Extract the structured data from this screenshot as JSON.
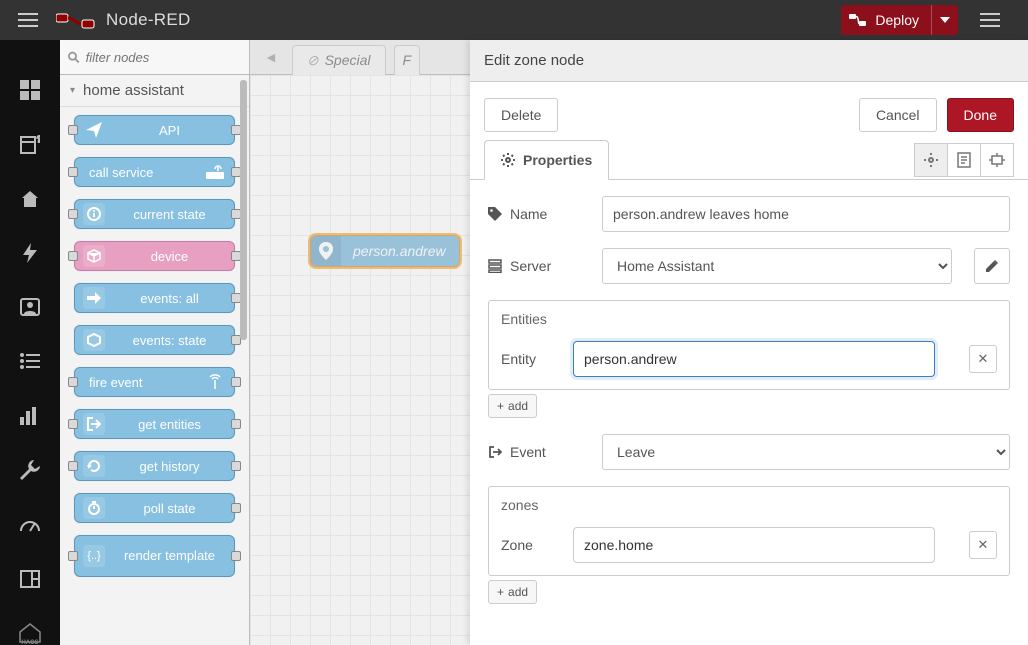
{
  "header": {
    "app_title": "Node-RED",
    "deploy_label": "Deploy"
  },
  "palette": {
    "filter_placeholder": "filter nodes",
    "category_label": "home assistant",
    "nodes": [
      {
        "label": "API"
      },
      {
        "label": "call service"
      },
      {
        "label": "current state"
      },
      {
        "label": "device"
      },
      {
        "label": "events: all"
      },
      {
        "label": "events: state"
      },
      {
        "label": "fire event"
      },
      {
        "label": "get entities"
      },
      {
        "label": "get history"
      },
      {
        "label": "poll state"
      },
      {
        "label": "render template"
      }
    ]
  },
  "tabs": {
    "tab1_label": "Special",
    "tab2_prefix": "F"
  },
  "canvas": {
    "node_label": "person.andrew"
  },
  "editor": {
    "title": "Edit zone node",
    "delete_label": "Delete",
    "cancel_label": "Cancel",
    "done_label": "Done",
    "properties_tab": "Properties",
    "name": {
      "label": "Name",
      "value": "person.andrew leaves home"
    },
    "server": {
      "label": "Server",
      "value": "Home Assistant"
    },
    "entities": {
      "heading": "Entities",
      "row_label": "Entity",
      "value": "person.andrew",
      "add_label": "add"
    },
    "event": {
      "label": "Event",
      "value": "Leave"
    },
    "zones": {
      "heading": "zones",
      "row_label": "Zone",
      "value": "zone.home",
      "add_label": "add"
    }
  }
}
